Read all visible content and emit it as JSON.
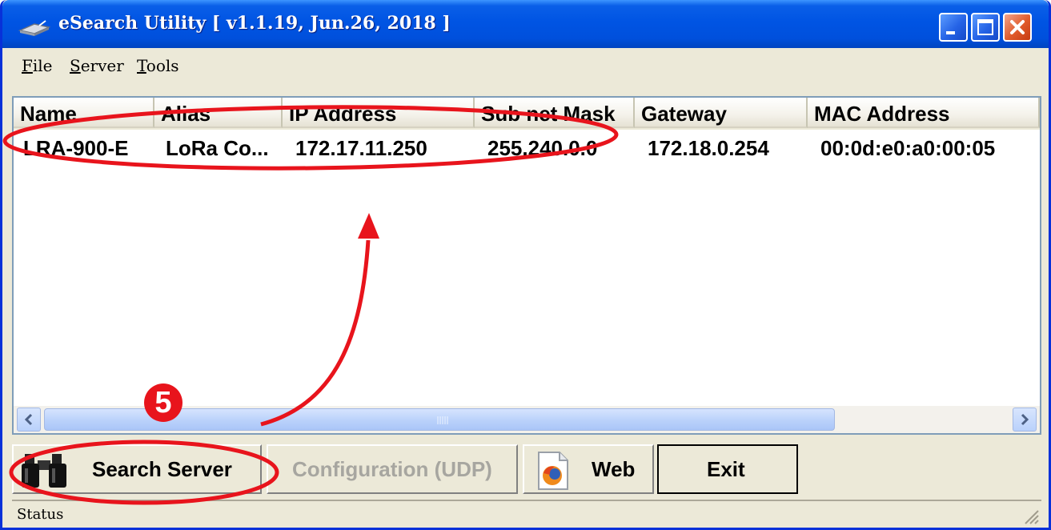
{
  "window": {
    "title": "eSearch Utility [ v1.1.19, Jun.26, 2018 ]",
    "title_bar_color": "#0054e3",
    "controls": [
      "minimize-icon",
      "maximize-icon",
      "close-icon"
    ]
  },
  "menu": {
    "file": "File",
    "server": "Server",
    "tools": "Tools"
  },
  "table": {
    "columns": [
      "Name",
      "Alias",
      "IP Address",
      "Sub net Mask",
      "Gateway",
      "MAC Address"
    ],
    "rows": [
      [
        "LRA-900-E",
        "LoRa Co...",
        "172.17.11.250",
        "255.240.0.0",
        "172.18.0.254",
        "00:0d:e0:a0:00:05"
      ]
    ]
  },
  "buttons": {
    "search": "Search Server",
    "config": "Configuration (UDP)",
    "web": "Web",
    "exit": "Exit"
  },
  "status": {
    "label": "Status"
  },
  "annotation": {
    "step": "5",
    "color": "#e8141c"
  }
}
